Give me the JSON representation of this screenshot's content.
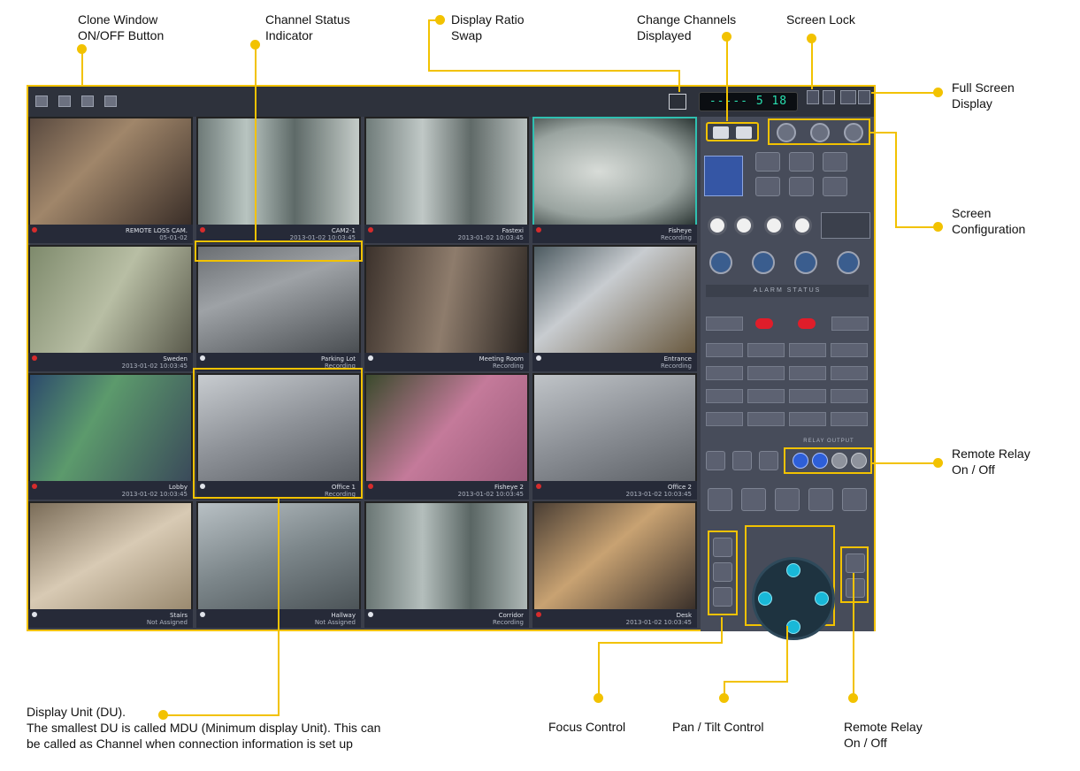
{
  "callouts": {
    "clone_window": "Clone Window\nON/OFF Button",
    "channel_status": "Channel Status\nIndicator",
    "display_ratio": "Display Ratio\nSwap",
    "change_channels": "Change Channels\nDisplayed",
    "screen_lock": "Screen Lock",
    "full_screen": "Full Screen\nDisplay",
    "screen_config": "Screen\nConfiguration",
    "remote_relay_right": "Remote Relay\nOn / Off",
    "display_unit": "Display Unit (DU).\nThe smallest DU is called MDU (Minimum display Unit). This can\nbe called as Channel when connection information is set up",
    "focus_control": "Focus Control",
    "pan_tilt": "Pan / Tilt Control",
    "remote_relay_bottom": "Remote Relay\nOn / Off"
  },
  "app": {
    "lcd_text": "----- 5 18",
    "alarm_header": "ALARM STATUS",
    "relay_header": "RELAY OUTPUT",
    "colors": {
      "accent": "#f2c200",
      "lcd": "#29e0b0",
      "alarm": "#e01d2a",
      "relay_on": "#2e5fd8"
    }
  },
  "cells": [
    {
      "line1": "REMOTE LOSS CAM.",
      "line2": "05-01-02",
      "status": "red"
    },
    {
      "line1": "CAM2-1",
      "line2": "2013-01-02 10:03:45",
      "status": "red"
    },
    {
      "line1": "Fastexi",
      "line2": "2013-01-02 10:03:45",
      "status": "red"
    },
    {
      "line1": "Fisheye",
      "line2": "Recording",
      "status": "red"
    },
    {
      "line1": "Sweden",
      "line2": "2013-01-02 10:03:45",
      "status": "red"
    },
    {
      "line1": "Parking Lot",
      "line2": "Recording",
      "status": "white"
    },
    {
      "line1": "Meeting Room",
      "line2": "Recording",
      "status": "white"
    },
    {
      "line1": "Entrance",
      "line2": "Recording",
      "status": "white"
    },
    {
      "line1": "Lobby",
      "line2": "2013-01-02 10:03:45",
      "status": "red"
    },
    {
      "line1": "Office 1",
      "line2": "Recording",
      "status": "white"
    },
    {
      "line1": "Fisheye 2",
      "line2": "2013-01-02 10:03:45",
      "status": "red"
    },
    {
      "line1": "Office 2",
      "line2": "2013-01-02 10:03:45",
      "status": "red"
    },
    {
      "line1": "Stairs",
      "line2": "Not Assigned",
      "status": "white"
    },
    {
      "line1": "Hallway",
      "line2": "Not Assigned",
      "status": "white"
    },
    {
      "line1": "Corridor",
      "line2": "Recording",
      "status": "white"
    },
    {
      "line1": "Desk",
      "line2": "2013-01-02 10:03:45",
      "status": "red"
    }
  ]
}
